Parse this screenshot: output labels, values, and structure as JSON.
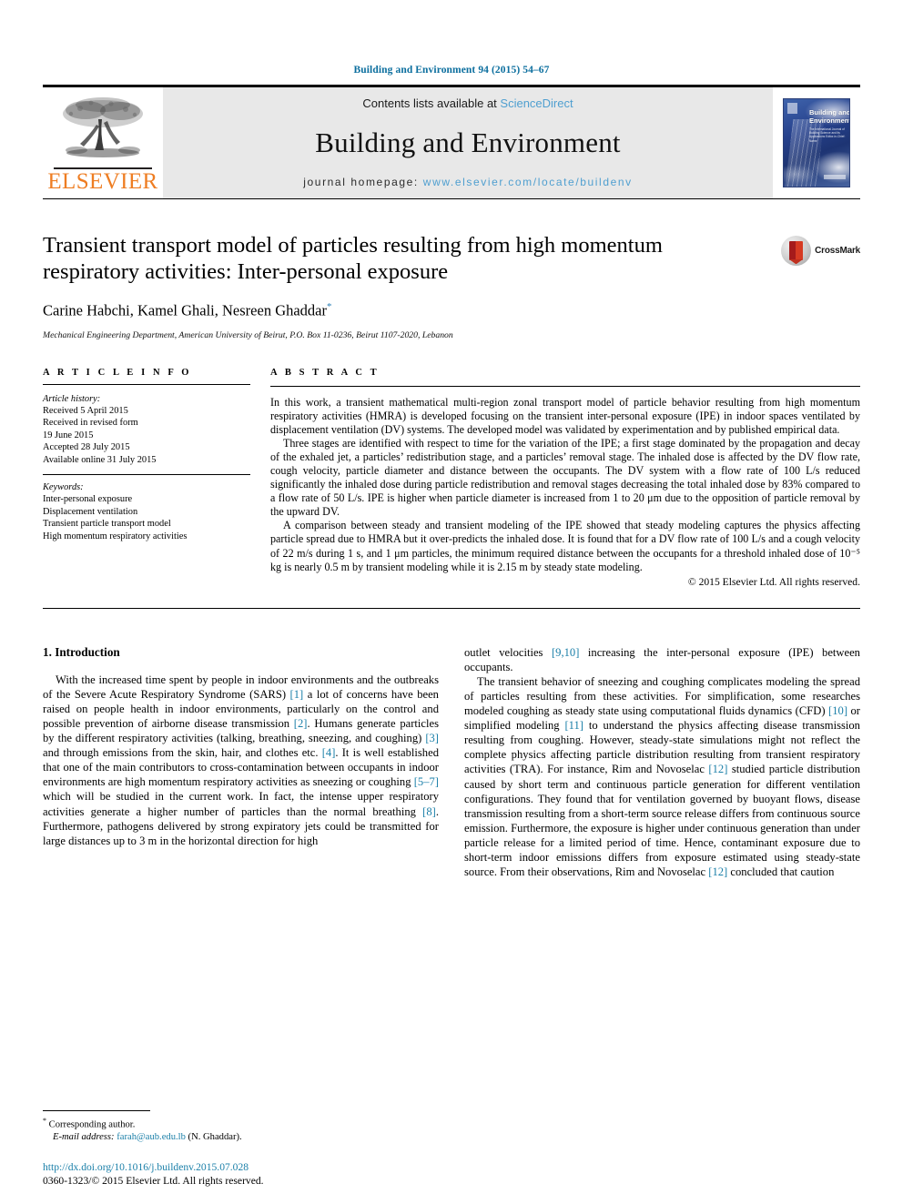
{
  "running_head": "Building and Environment 94 (2015) 54–67",
  "masthead": {
    "publisher": "ELSEVIER",
    "contents_prefix": "Contents lists available at ",
    "contents_link": "ScienceDirect",
    "journal_name": "Building and Environment",
    "homepage_prefix": "journal homepage: ",
    "homepage_url": "www.elsevier.com/locate/buildenv",
    "cover_title_line1": "Building and",
    "cover_title_line2": "Environment",
    "cover_subtitle": "The International Journal of Building Science and its Applications Editor-in-Chief: Name"
  },
  "article": {
    "title": "Transient transport model of particles resulting from high momentum respiratory activities: Inter-personal exposure",
    "authors": "Carine Habchi, Kamel Ghali, Nesreen Ghaddar",
    "author_star": "*",
    "affiliation": "Mechanical Engineering Department, American University of Beirut, P.O. Box 11-0236, Beirut 1107-2020, Lebanon",
    "crossmark_label": "CrossMark"
  },
  "info": {
    "heading": "A R T I C L E   I N F O",
    "history_label": "Article history:",
    "history": [
      "Received 5 April 2015",
      "Received in revised form",
      "19 June 2015",
      "Accepted 28 July 2015",
      "Available online 31 July 2015"
    ],
    "keywords_label": "Keywords:",
    "keywords": [
      "Inter-personal exposure",
      "Displacement ventilation",
      "Transient particle transport model",
      "High momentum respiratory activities"
    ]
  },
  "abstract": {
    "heading": "A B S T R A C T",
    "paragraphs": [
      "In this work, a transient mathematical multi-region zonal transport model of particle behavior resulting from high momentum respiratory activities (HMRA) is developed focusing on the transient inter-personal exposure (IPE) in indoor spaces ventilated by displacement ventilation (DV) systems. The developed model was validated by experimentation and by published empirical data.",
      "Three stages are identified with respect to time for the variation of the IPE; a first stage dominated by the propagation and decay of the exhaled jet, a particles’ redistribution stage, and a particles’ removal stage. The inhaled dose is affected by the DV flow rate, cough velocity, particle diameter and distance between the occupants. The DV system with a flow rate of 100 L/s reduced significantly the inhaled dose during particle redistribution and removal stages decreasing the total inhaled dose by 83% compared to a flow rate of 50 L/s. IPE is higher when particle diameter is increased from 1 to 20 μm due to the opposition of particle removal by the upward DV.",
      "A comparison between steady and transient modeling of the IPE showed that steady modeling captures the physics affecting particle spread due to HMRA but it over-predicts the inhaled dose. It is found that for a DV flow rate of 100 L/s and a cough velocity of 22 m/s during 1 s, and 1 μm particles, the minimum required distance between the occupants for a threshold inhaled dose of 10⁻⁵ kg is nearly 0.5 m by transient modeling while it is 2.15 m by steady state modeling."
    ],
    "copyright": "© 2015 Elsevier Ltd. All rights reserved."
  },
  "introduction": {
    "heading": "1. Introduction",
    "left_paragraph_1_part1": "With the increased time spent by people in indoor environments and the outbreaks of the Severe Acute Respiratory Syndrome (SARS) ",
    "ref1": "[1]",
    "left_paragraph_1_part2": " a lot of concerns have been raised on people health in indoor environments, particularly on the control and possible prevention of airborne disease transmission ",
    "ref2": "[2]",
    "left_paragraph_1_part3": ". Humans generate particles by the different respiratory activities (talking, breathing, sneezing, and coughing) ",
    "ref3": "[3]",
    "left_paragraph_1_part4": " and through emissions from the skin, hair, and clothes etc. ",
    "ref4": "[4]",
    "left_paragraph_1_part5": ". It is well established that one of the main contributors to cross-contamination between occupants in indoor environments are high momentum respiratory activities as sneezing or coughing ",
    "ref5": "[5–7]",
    "left_paragraph_1_part6": " which will be studied in the current work. In fact, the intense upper respiratory activities generate a higher number of particles than the normal breathing ",
    "ref6": "[8]",
    "left_paragraph_1_part7": ". Furthermore, pathogens delivered by strong expiratory jets could be transmitted for large distances up to 3 m in the horizontal direction for high",
    "right_paragraph_1_part1": "outlet velocities ",
    "ref7": "[9,10]",
    "right_paragraph_1_part2": " increasing the inter-personal exposure (IPE) between occupants.",
    "right_paragraph_2_part1": "The transient behavior of sneezing and coughing complicates modeling the spread of particles resulting from these activities. For simplification, some researches modeled coughing as steady state using computational fluids dynamics (CFD) ",
    "ref8": "[10]",
    "right_paragraph_2_part2": " or simplified modeling ",
    "ref9": "[11]",
    "right_paragraph_2_part3": " to understand the physics affecting disease transmission resulting from coughing. However, steady-state simulations might not reflect the complete physics affecting particle distribution resulting from transient respiratory activities (TRA). For instance, Rim and Novoselac ",
    "ref10": "[12]",
    "right_paragraph_2_part4": " studied particle distribution caused by short term and continuous particle generation for different ventilation configurations. They found that for ventilation governed by buoyant flows, disease transmission resulting from a short-term source release differs from continuous source emission. Furthermore, the exposure is higher under continuous generation than under particle release for a limited period of time. Hence, contaminant exposure due to short-term indoor emissions differs from exposure estimated using steady-state source. From their observations, Rim and Novoselac ",
    "ref11": "[12]",
    "right_paragraph_2_part5": " concluded that caution"
  },
  "footer": {
    "corresponding_star": "*",
    "corresponding_label": " Corresponding author.",
    "email_label": "E-mail address:",
    "email": "farah@aub.edu.lb",
    "email_suffix": " (N. Ghaddar).",
    "doi": "http://dx.doi.org/10.1016/j.buildenv.2015.07.028",
    "issn": "0360-1323/© 2015 Elsevier Ltd. All rights reserved."
  }
}
